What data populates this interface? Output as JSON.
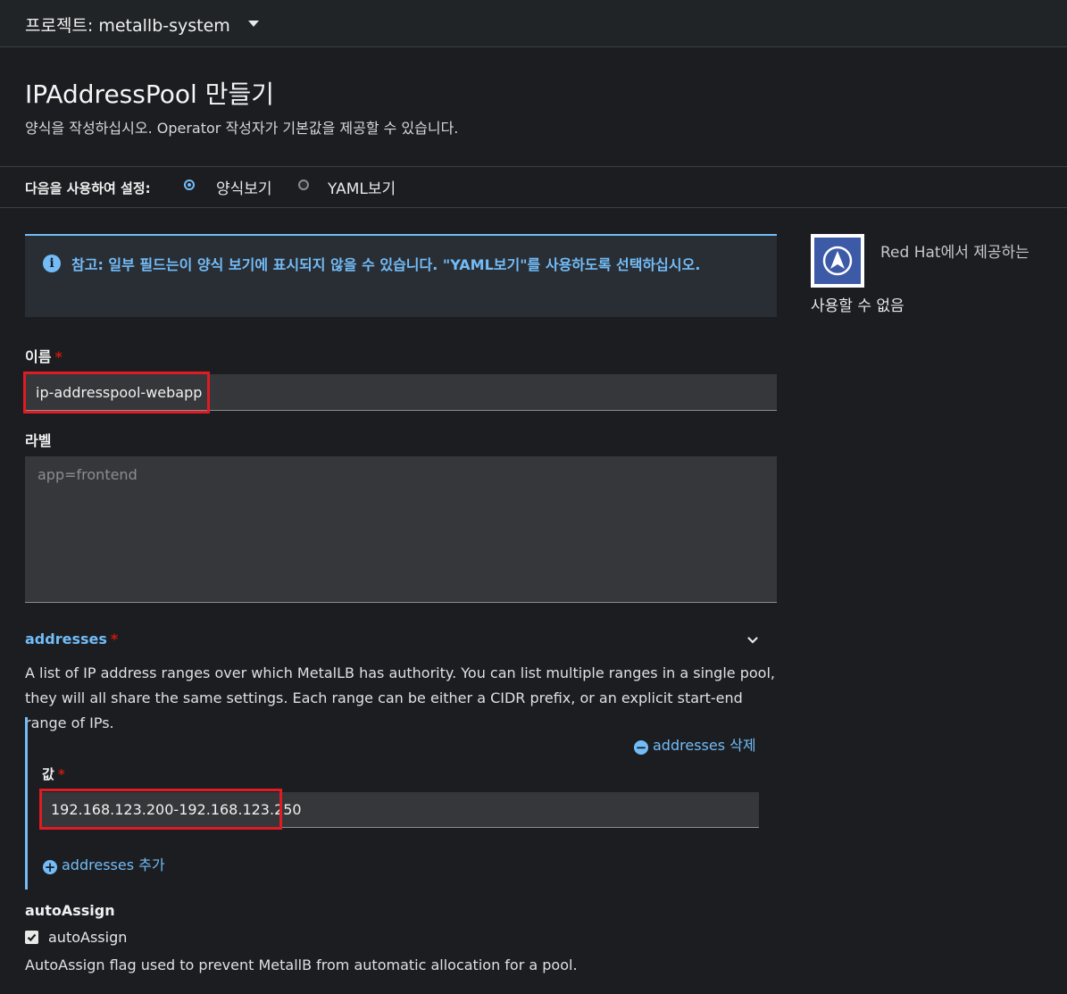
{
  "topbar": {
    "project_label": "프로젝트: metallb-system"
  },
  "header": {
    "title": "IPAddressPool 만들기",
    "subtitle": "양식을 작성하십시오. Operator 작성자가 기본값을 제공할 수 있습니다."
  },
  "config": {
    "label": "다음을 사용하여 설정:",
    "options": [
      {
        "label": "양식보기",
        "selected": true
      },
      {
        "label": "YAML보기",
        "selected": false
      }
    ]
  },
  "alert": {
    "text": "참고: 일부 필드는이 양식 보기에 표시되지 않을 수 있습니다. \"YAML보기\"를 사용하도록 선택하십시오."
  },
  "form": {
    "name": {
      "label": "이름",
      "required_mark": "*",
      "value": "ip-addresspool-webapp"
    },
    "labels": {
      "label": "라벨",
      "placeholder": "app=frontend",
      "value": ""
    },
    "addresses": {
      "title": "addresses",
      "required_mark": "*",
      "description": "A list of IP address ranges over which MetalLB has authority. You can list multiple ranges in a single pool, they will all share the same settings. Each range can be either a CIDR prefix, or an explicit start-end range of IPs.",
      "remove_label": "addresses 삭제",
      "value_label": "값",
      "value": "192.168.123.200-192.168.123.250",
      "add_label": "addresses 추가"
    },
    "auto_assign": {
      "title": "autoAssign",
      "checkbox_label": "autoAssign",
      "checked": true,
      "description": "AutoAssign flag used to prevent MetallB from automatic allocation for a pool."
    }
  },
  "provider": {
    "name": "Red Hat에서 제공하는",
    "status": "사용할 수 없음"
  },
  "colors": {
    "accent": "#73bcf7",
    "highlight": "#e01b24",
    "required": "#c9190b"
  }
}
